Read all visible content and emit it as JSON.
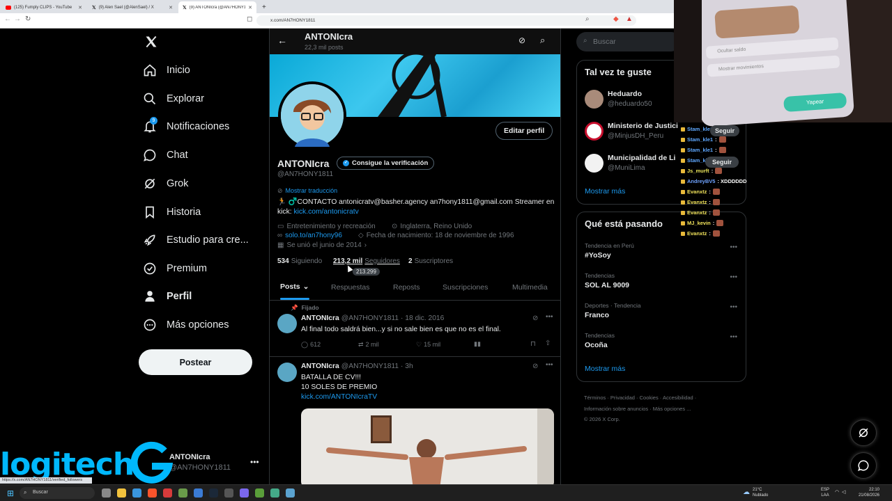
{
  "browser": {
    "tabs": [
      {
        "label": "(125) Fumply CLIPS - YouTube",
        "icon": "youtube-icon"
      },
      {
        "label": "(9) Alen Sael (@AlenSael) / X",
        "icon": "x-logo-icon"
      },
      {
        "label": "(9) ANTONIcra (@AN7HONY18",
        "icon": "x-logo-icon"
      }
    ],
    "url": "x.com/AN7HONY1811"
  },
  "nav": {
    "items": [
      {
        "label": "Inicio",
        "icon": "home-icon"
      },
      {
        "label": "Explorar",
        "icon": "search-icon"
      },
      {
        "label": "Notificaciones",
        "icon": "bell-icon",
        "badge": "9"
      },
      {
        "label": "Chat",
        "icon": "chat-icon"
      },
      {
        "label": "Grok",
        "icon": "grok-icon"
      },
      {
        "label": "Historia",
        "icon": "bookmark-icon"
      },
      {
        "label": "Estudio para cre...",
        "icon": "rocket-icon"
      },
      {
        "label": "Premium",
        "icon": "verified-icon"
      },
      {
        "label": "Perfil",
        "icon": "person-icon"
      },
      {
        "label": "Más opciones",
        "icon": "more-circle-icon"
      }
    ],
    "post_label": "Postear",
    "account": {
      "name": "ANTONIcra",
      "handle": "@AN7HONY1811"
    }
  },
  "profile": {
    "header_name": "ANTONIcra",
    "header_posts": "22,3 mil posts",
    "edit_label": "Editar perfil",
    "name": "ANTONIcra",
    "verify_label": "Consigue la verificación",
    "handle": "@AN7HONY1811",
    "translate_label": "Mostrar traducción",
    "bio_text": "🏃 ♂️CONTACTO antonicratv@basher.agency an7hony1811@gmail.com Streamer en kick: ",
    "bio_link": "kick.com/antonicratv",
    "category": "Entretenimiento y recreación",
    "location": "Inglaterra, Reino Unido",
    "website": "solo.to/an7hony96",
    "birth": "Fecha de nacimiento: 18 de noviembre de 1996",
    "joined": "Se unió el junio de 2014",
    "following_count": "534",
    "following_label": "Siguiendo",
    "followers_count": "213,2 mil",
    "followers_label": "Seguidores",
    "subs_count": "2",
    "subs_label": "Suscriptores",
    "tooltip": "213.299",
    "tabs": [
      "Posts",
      "Respuestas",
      "Reposts",
      "Suscripciones",
      "Multimedia"
    ]
  },
  "tweets": [
    {
      "pinned_label": "Fijado",
      "name": "ANTONIcra",
      "meta": "@AN7HONY1811 · 18 dic. 2016",
      "text": "Al final todo saldrá bien...y si no sale bien es que no es el final.",
      "replies": "612",
      "reposts": "2 mil",
      "likes": "15 mil"
    },
    {
      "name": "ANTONIcra",
      "meta": "@AN7HONY1811 · 3h",
      "line1": "BATALLA DE CV!!!",
      "line2": "10 SOLES DE PREMIO",
      "link": "kick.com/ANTONIcraTV"
    }
  ],
  "right": {
    "search_placeholder": "Buscar",
    "suggest_title": "Tal vez te guste",
    "suggestions": [
      {
        "name": "Heduardo",
        "handle": "@heduardo50"
      },
      {
        "name": "Ministerio de Justici",
        "handle": "@MinjusDH_Peru"
      },
      {
        "name": "Municipalidad de Li",
        "handle": "@MuniLima"
      }
    ],
    "follow_label": "Seguir",
    "show_more": "Mostrar más",
    "trends_title": "Qué está pasando",
    "trends": [
      {
        "sub": "Tendencia en Perú",
        "name": "#YoSoy"
      },
      {
        "sub": "Tendencias",
        "name": "SOL AL 9009"
      },
      {
        "sub": "Deportes · Tendencia",
        "name": "Franco"
      },
      {
        "sub": "Tendencias",
        "name": "Ocoña"
      }
    ],
    "footer_line1": "Términos · Privacidad · Cookies · Accesibilidad ·",
    "footer_line2": "Información sobre anuncios · Más opciones ...",
    "footer_line3": "© 2026 X Corp."
  },
  "chat": [
    {
      "user": "Stam_kle1",
      "msg": ":",
      "color": "#5fa8ff"
    },
    {
      "user": "Stam_kle1",
      "msg": ":",
      "color": "#5fa8ff"
    },
    {
      "user": "Stam_kle1",
      "msg": ":",
      "color": "#5fa8ff"
    },
    {
      "user": "Stam_kle1",
      "msg": "",
      "color": "#5fa8ff"
    },
    {
      "user": "Js_murft",
      "msg": ":",
      "color": "#e7e25a"
    },
    {
      "user": "AndreyBV5",
      "msg": ": XDDDDDD",
      "color": "#6fa3ff"
    },
    {
      "user": "Evanxtz",
      "msg": ":",
      "color": "#f0e25b"
    },
    {
      "user": "Evanxtz",
      "msg": ":",
      "color": "#f0e25b"
    },
    {
      "user": "Evanxtz",
      "msg": ":",
      "color": "#f0e25b"
    },
    {
      "user": "MJ_kevin",
      "msg": ":",
      "color": "#f0e25b"
    },
    {
      "user": "Evanxtz",
      "msg": ":",
      "color": "#f0e25b"
    }
  ],
  "webcam": {
    "phone_line1": "Ocultar saldo",
    "phone_line2": "Mostrar movimientos",
    "phone_btn": "Yapear"
  },
  "logitech": "logitech",
  "status_url": "https://x.com/AN7HONY1811/verified_followers",
  "taskbar": {
    "search": "Buscar",
    "weather": "21°C",
    "weather_sub": "Nublado",
    "lang1": "ESP",
    "lang2": "LAA",
    "time": "22:10",
    "date": "21/08/2026"
  }
}
